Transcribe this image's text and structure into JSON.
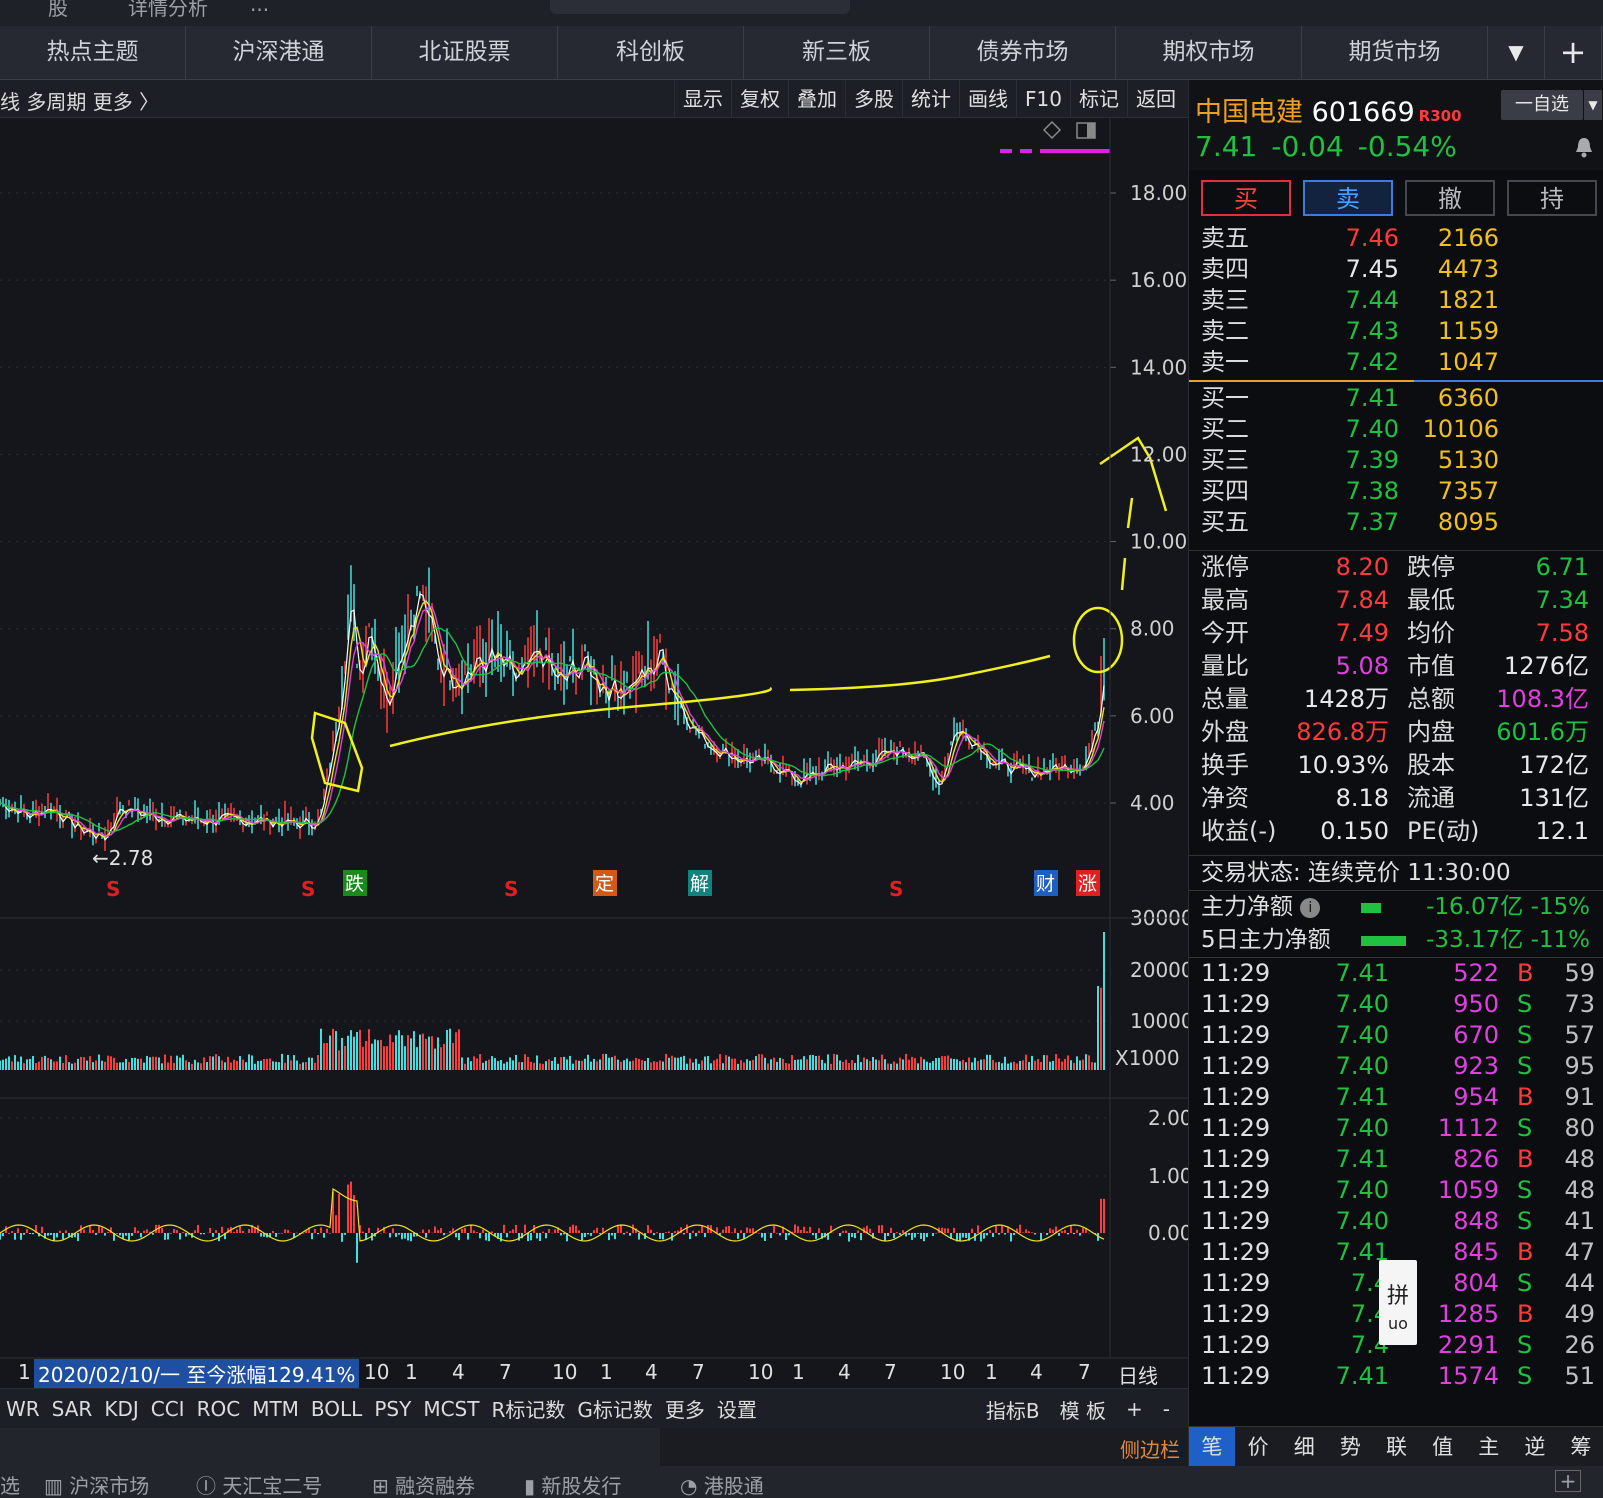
{
  "topbar": {
    "items": [
      "股",
      "详情分析",
      "..."
    ]
  },
  "nav": {
    "tabs": [
      "热点主题",
      "沪深港通",
      "北证股票",
      "科创板",
      "新三板",
      "债券市场",
      "期权市场",
      "期货市场"
    ],
    "more": "▼",
    "add": "+"
  },
  "toolbar": {
    "left": "线  多周期  更多 〉",
    "right": [
      "显示",
      "复权",
      "叠加",
      "多股",
      "统计",
      "画线",
      "F10",
      "标记",
      "返回"
    ]
  },
  "chart": {
    "yaxis_price": [
      "18.00",
      "16.00",
      "14.00",
      "12.00",
      "10.00",
      "8.00",
      "6.00",
      "4.00"
    ],
    "low_label": "2.78",
    "yaxis_volume": [
      "30000",
      "20000",
      "10000",
      "X1000"
    ],
    "yaxis_ind": [
      "2.00",
      "1.00",
      "0.00"
    ],
    "markers": [
      {
        "t": "S",
        "c": "#e02020"
      },
      {
        "t": "S",
        "c": "#e02020"
      },
      {
        "t": "跌",
        "c": "#1a8a1a"
      },
      {
        "t": "S",
        "c": "#e02020"
      },
      {
        "t": "定",
        "c": "#d05a18"
      },
      {
        "t": "解",
        "c": "#12827e"
      },
      {
        "t": "S",
        "c": "#e02020"
      },
      {
        "t": "财",
        "c": "#1f5fc0"
      },
      {
        "t": "涨",
        "c": "#e02020"
      }
    ],
    "date_label": "2020/02/10/一  至今涨幅129.41%",
    "xaxis": [
      "1",
      "10",
      "1",
      "4",
      "7",
      "10",
      "1",
      "4",
      "7",
      "10",
      "1",
      "4",
      "7",
      "10",
      "1",
      "4",
      "7"
    ],
    "period": "日线",
    "colors": {
      "up": "#ff3a3a",
      "down": "#40e0e0",
      "ma1": "#ffffff",
      "ma2": "#f0e020",
      "ma3": "#e040e0",
      "ma4": "#20c040",
      "annot": "#f0f020"
    }
  },
  "indicators": {
    "tabs": [
      "WR",
      "SAR",
      "KDJ",
      "CCI",
      "ROC",
      "MTM",
      "BOLL",
      "PSY",
      "MCST",
      "R标记数",
      "G标记数",
      "更多",
      "设置"
    ],
    "right": [
      "指标B",
      "模 板",
      "+",
      "-"
    ]
  },
  "sidebar_label": "侧边栏",
  "statusbar": [
    "选",
    "沪深市场",
    "天汇宝二号",
    "融资融券",
    "新股发行",
    "港股通"
  ],
  "stock": {
    "name": "中国电建",
    "code": "601669",
    "badge": "R300",
    "watch": "一自选",
    "watch_arrow": "▼",
    "price": "7.41",
    "change": "-0.04",
    "pct": "-0.54%"
  },
  "trade_buttons": [
    "买",
    "卖",
    "撤",
    "持"
  ],
  "orderbook": {
    "asks": [
      {
        "label": "卖五",
        "price": "7.46",
        "vol": "2166",
        "c": "red"
      },
      {
        "label": "卖四",
        "price": "7.45",
        "vol": "4473",
        "c": "white"
      },
      {
        "label": "卖三",
        "price": "7.44",
        "vol": "1821",
        "c": "green"
      },
      {
        "label": "卖二",
        "price": "7.43",
        "vol": "1159",
        "c": "green"
      },
      {
        "label": "卖一",
        "price": "7.42",
        "vol": "1047",
        "c": "green"
      }
    ],
    "bids": [
      {
        "label": "买一",
        "price": "7.41",
        "vol": "6360",
        "c": "green"
      },
      {
        "label": "买二",
        "price": "7.40",
        "vol": "10106",
        "c": "green"
      },
      {
        "label": "买三",
        "price": "7.39",
        "vol": "5130",
        "c": "green"
      },
      {
        "label": "买四",
        "price": "7.38",
        "vol": "7357",
        "c": "green"
      },
      {
        "label": "买五",
        "price": "7.37",
        "vol": "8095",
        "c": "green"
      }
    ]
  },
  "stats": [
    {
      "k1": "涨停",
      "v1": "8.20",
      "c1": "red",
      "k2": "跌停",
      "v2": "6.71",
      "c2": "green"
    },
    {
      "k1": "最高",
      "v1": "7.84",
      "c1": "red",
      "k2": "最低",
      "v2": "7.34",
      "c2": "green"
    },
    {
      "k1": "今开",
      "v1": "7.49",
      "c1": "red",
      "k2": "均价",
      "v2": "7.58",
      "c2": "red"
    },
    {
      "k1": "量比",
      "v1": "5.08",
      "c1": "magenta",
      "k2": "市值",
      "v2": "1276亿",
      "c2": "white"
    },
    {
      "k1": "总量",
      "v1": "1428万",
      "c1": "white",
      "k2": "总额",
      "v2": "108.3亿",
      "c2": "magenta"
    },
    {
      "k1": "外盘",
      "v1": "826.8万",
      "c1": "red",
      "k2": "内盘",
      "v2": "601.6万",
      "c2": "green"
    },
    {
      "k1": "换手",
      "v1": "10.93%",
      "c1": "white",
      "k2": "股本",
      "v2": "172亿",
      "c2": "white"
    },
    {
      "k1": "净资",
      "v1": "8.18",
      "c1": "white",
      "k2": "流通",
      "v2": "131亿",
      "c2": "white"
    },
    {
      "k1": "收益(-)",
      "v1": "0.150",
      "c1": "white",
      "k2": "PE(动)",
      "v2": "12.1",
      "c2": "white"
    }
  ],
  "trade_status": "交易状态: 连续竞价 11:30:00",
  "flow": [
    {
      "k": "主力净额",
      "v": "-16.07亿 -15%",
      "bar": 0.2
    },
    {
      "k": "5日主力净额",
      "v": "-33.17亿 -11%",
      "bar": 0.45
    }
  ],
  "ticks": [
    {
      "t": "11:29",
      "p": "7.41",
      "v": "522",
      "d": "B",
      "n": "59"
    },
    {
      "t": "11:29",
      "p": "7.40",
      "v": "950",
      "d": "S",
      "n": "73"
    },
    {
      "t": "11:29",
      "p": "7.40",
      "v": "670",
      "d": "S",
      "n": "57"
    },
    {
      "t": "11:29",
      "p": "7.40",
      "v": "923",
      "d": "S",
      "n": "95"
    },
    {
      "t": "11:29",
      "p": "7.41",
      "v": "954",
      "d": "B",
      "n": "91"
    },
    {
      "t": "11:29",
      "p": "7.40",
      "v": "1112",
      "d": "S",
      "n": "80"
    },
    {
      "t": "11:29",
      "p": "7.41",
      "v": "826",
      "d": "B",
      "n": "48"
    },
    {
      "t": "11:29",
      "p": "7.40",
      "v": "1059",
      "d": "S",
      "n": "48"
    },
    {
      "t": "11:29",
      "p": "7.40",
      "v": "848",
      "d": "S",
      "n": "41"
    },
    {
      "t": "11:29",
      "p": "7.41",
      "v": "845",
      "d": "B",
      "n": "47"
    },
    {
      "t": "11:29",
      "p": "7.4",
      "v": "804",
      "d": "S",
      "n": "44"
    },
    {
      "t": "11:29",
      "p": "7.4",
      "v": "1285",
      "d": "B",
      "n": "49"
    },
    {
      "t": "11:29",
      "p": "7.4",
      "v": "2291",
      "d": "S",
      "n": "26"
    },
    {
      "t": "11:29",
      "p": "7.41",
      "v": "1574",
      "d": "S",
      "n": "51"
    }
  ],
  "popup": "拼\nuo",
  "panel_tabs": [
    "笔",
    "价",
    "细",
    "势",
    "联",
    "值",
    "主",
    "逆",
    "筹"
  ]
}
